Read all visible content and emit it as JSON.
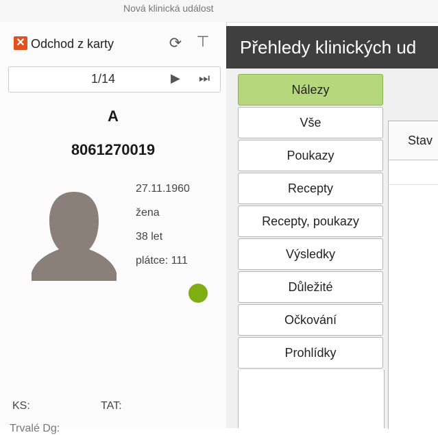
{
  "window": {
    "title": "Nová klinická událost"
  },
  "toolbar": {
    "exit_label": "Odchod z karty"
  },
  "pager": {
    "current": "1/14"
  },
  "patient": {
    "name": "A",
    "id": "8061270019",
    "birth_date": "27.11.1960",
    "gender": "žena",
    "age": "38 let",
    "payer": "plátce: 111",
    "status_color": "#7fae12"
  },
  "footer": {
    "ks_label": "KS:",
    "tat_label": "TAT:",
    "partial_text": "Trvalé Dg:"
  },
  "main": {
    "title": "Přehledy klinických ud",
    "tabs": [
      {
        "label": "Nálezy",
        "active": true
      },
      {
        "label": "Vše"
      },
      {
        "label": "Poukazy"
      },
      {
        "label": "Recepty"
      },
      {
        "label": "Recepty, poukazy"
      },
      {
        "label": "Výsledky"
      },
      {
        "label": "Důležité"
      },
      {
        "label": "Očkování"
      },
      {
        "label": "Prohlídky"
      }
    ],
    "grid": {
      "columns": [
        "Stav"
      ]
    }
  },
  "colors": {
    "accent_tab": "#b7d77d",
    "header_bg": "#3f3f3f",
    "exit_icon": "#e0521f"
  },
  "icons": [
    "close-icon",
    "refresh-icon",
    "pin-icon",
    "next-icon",
    "last-icon",
    "avatar-silhouette",
    "status-dot"
  ]
}
